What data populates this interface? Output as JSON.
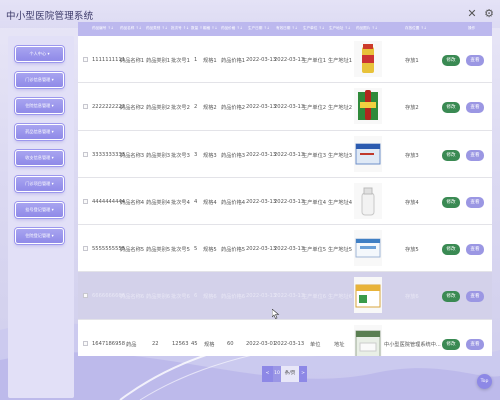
{
  "app": {
    "title": "中小型医院管理系统"
  },
  "top_icons": {
    "close": "x",
    "settings": "gear"
  },
  "sidebar": {
    "items": [
      {
        "label": "个人中心 ▾"
      },
      {
        "label": "门诊信息管理 ▾"
      },
      {
        "label": "住院信息管理 ▾"
      },
      {
        "label": "药品信息管理 ▾"
      },
      {
        "label": "收支信息管理 ▾"
      },
      {
        "label": "门诊项目管理 ▾"
      },
      {
        "label": "挂号登记管理 ▾"
      },
      {
        "label": "住院登记管理 ▾"
      }
    ]
  },
  "table": {
    "columns": [
      "药品编号 ↑↓",
      "药品名称 ↑↓",
      "药品类别 ↑↓",
      "批次号 ↑↓",
      "数量 ↑↓",
      "规格 ↑↓",
      "药品价格 ↑↓",
      "生产日期 ↑↓",
      "有效日期 ↑↓",
      "生产单位 ↑↓",
      "生产地址 ↑↓",
      "药品图片 ↑↓",
      "存放位置 ↑↓",
      "操作"
    ],
    "rows": [
      {
        "code": "1111111111",
        "name": "药品名称1",
        "category": "药品类别1",
        "batch": "批次号1",
        "qty": "1",
        "spec": "规格1",
        "price": "药品价格1",
        "prod_date": "2022-03-13",
        "expire_date": "2022-03-13",
        "maker": "生产单位1",
        "address": "生产地址1",
        "location": "存放1",
        "edit": "修改",
        "view": "查看"
      },
      {
        "code": "2222222222",
        "name": "药品名称2",
        "category": "药品类别2",
        "batch": "批次号2",
        "qty": "2",
        "spec": "规格2",
        "price": "药品价格2",
        "prod_date": "2022-03-13",
        "expire_date": "2022-03-13",
        "maker": "生产单位2",
        "address": "生产地址2",
        "location": "存放2",
        "edit": "修改",
        "view": "查看"
      },
      {
        "code": "3333333333",
        "name": "药品名称3",
        "category": "药品类别3",
        "batch": "批次号3",
        "qty": "3",
        "spec": "规格3",
        "price": "药品价格3",
        "prod_date": "2022-03-13",
        "expire_date": "2022-03-13",
        "maker": "生产单位3",
        "address": "生产地址3",
        "location": "存放3",
        "edit": "修改",
        "view": "查看"
      },
      {
        "code": "4444444444",
        "name": "药品名称4",
        "category": "药品类别4",
        "batch": "批次号4",
        "qty": "4",
        "spec": "规格4",
        "price": "药品价格4",
        "prod_date": "2022-03-13",
        "expire_date": "2022-03-13",
        "maker": "生产单位4",
        "address": "生产地址4",
        "location": "存放4",
        "edit": "修改",
        "view": "查看"
      },
      {
        "code": "5555555555",
        "name": "药品名称5",
        "category": "药品类别5",
        "batch": "批次号5",
        "qty": "5",
        "spec": "规格5",
        "price": "药品价格5",
        "prod_date": "2022-03-13",
        "expire_date": "2022-03-13",
        "maker": "生产单位5",
        "address": "生产地址5",
        "location": "存放5",
        "edit": "修改",
        "view": "查看"
      },
      {
        "code": "6666666666",
        "name": "药品名称6",
        "category": "药品类别6",
        "batch": "批次号6",
        "qty": "6",
        "spec": "规格6",
        "price": "药品价格6",
        "prod_date": "2022-03-13",
        "expire_date": "2022-03-13",
        "maker": "生产单位6",
        "address": "生产地址6",
        "location": "存放6",
        "edit": "修改",
        "view": "查看"
      },
      {
        "code": "1647186958",
        "name": "药品",
        "category": "22",
        "batch": "12563",
        "qty": "45",
        "spec": "规格",
        "price": "60",
        "prod_date": "2022-03-01",
        "expire_date": "2022-03-13",
        "maker": "单位",
        "address": "地址",
        "location": "中小型医院管理系统中...",
        "edit": "修改",
        "view": "查看"
      }
    ]
  },
  "pagination": {
    "prev": "<",
    "current": "10",
    "size_label": "条/页",
    "next": ">"
  },
  "back_to_top": {
    "label": "Top"
  }
}
